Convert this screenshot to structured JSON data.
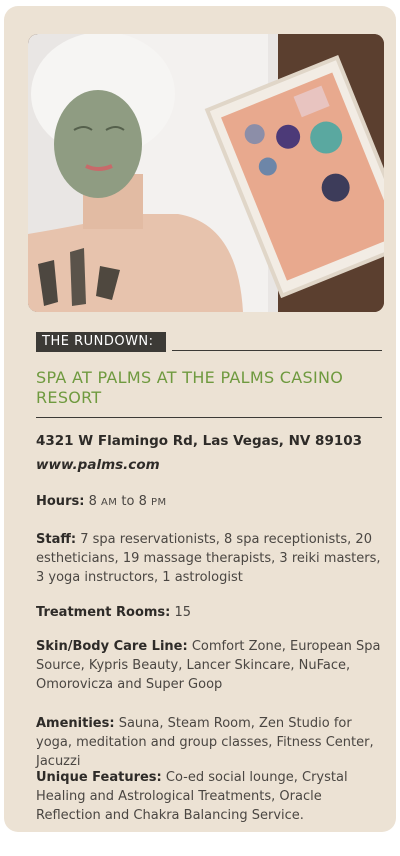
{
  "photo": {
    "alt": "Woman with green face mask and towel, crystals on chest, tray of crystals and salts"
  },
  "header": {
    "tag": "THE RUNDOWN:",
    "title": "SPA AT PALMS AT THE PALMS CASINO RESORT"
  },
  "contact": {
    "address": "4321 W Flamingo Rd, Las Vegas, NV 89103",
    "website": "www.palms.com"
  },
  "hours": {
    "label": "Hours:",
    "open": "8",
    "open_suffix": "AM",
    "to": "to",
    "close": "8",
    "close_suffix": "PM"
  },
  "staff": {
    "label": "Staff:",
    "value": "7 spa reservationists, 8 spa receptionists, 20 estheticians, 19 massage therapists, 3 reiki masters, 3 yoga instructors, 1 astrologist"
  },
  "rooms": {
    "label": "Treatment Rooms:",
    "value": "15"
  },
  "line": {
    "label": "Skin/Body Care Line:",
    "value": "Comfort Zone, European Spa Source, Kypris Beauty, Lancer Skincare, NuFace, Omorovicza and Super Goop"
  },
  "amenities": {
    "label": "Amenities:",
    "value": "Sauna, Steam Room, Zen Studio for yoga, meditation and group classes, Fitness Center, Jacuzzi"
  },
  "unique": {
    "label": "Unique Features:",
    "value": "Co-ed social lounge, Crystal Healing and Astrological Treatments, Oracle Reflection and Chakra Balancing Service."
  },
  "colors": {
    "accent": "#6f9a3f",
    "card": "#ece2d4",
    "dark": "#3c3a36"
  }
}
